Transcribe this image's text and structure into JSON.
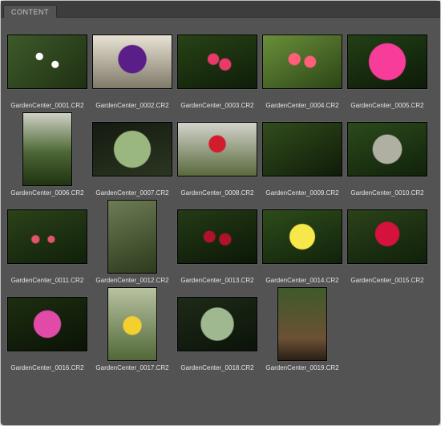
{
  "panel": {
    "tab_label": "CONTENT"
  },
  "files": [
    {
      "name": "GardenCenter_0001.CR2",
      "orient": "landscape",
      "palette": "p1"
    },
    {
      "name": "GardenCenter_0002.CR2",
      "orient": "landscape",
      "palette": "p2"
    },
    {
      "name": "GardenCenter_0003.CR2",
      "orient": "landscape",
      "palette": "p3"
    },
    {
      "name": "GardenCenter_0004.CR2",
      "orient": "landscape",
      "palette": "p4"
    },
    {
      "name": "GardenCenter_0005.CR2",
      "orient": "landscape",
      "palette": "p5"
    },
    {
      "name": "GardenCenter_0006.CR2",
      "orient": "portrait",
      "palette": "p6"
    },
    {
      "name": "GardenCenter_0007.CR2",
      "orient": "landscape",
      "palette": "p7"
    },
    {
      "name": "GardenCenter_0008.CR2",
      "orient": "landscape",
      "palette": "p8"
    },
    {
      "name": "GardenCenter_0009.CR2",
      "orient": "landscape",
      "palette": "p9"
    },
    {
      "name": "GardenCenter_0010.CR2",
      "orient": "landscape",
      "palette": "p10"
    },
    {
      "name": "GardenCenter_0011.CR2",
      "orient": "landscape",
      "palette": "p11"
    },
    {
      "name": "GardenCenter_0012.CR2",
      "orient": "portrait",
      "palette": "p12"
    },
    {
      "name": "GardenCenter_0013.CR2",
      "orient": "landscape",
      "palette": "p13"
    },
    {
      "name": "GardenCenter_0014.CR2",
      "orient": "landscape",
      "palette": "p14"
    },
    {
      "name": "GardenCenter_0015.CR2",
      "orient": "landscape",
      "palette": "p15"
    },
    {
      "name": "GardenCenter_0016.CR2",
      "orient": "landscape",
      "palette": "p16"
    },
    {
      "name": "GardenCenter_0017.CR2",
      "orient": "portrait",
      "palette": "p17"
    },
    {
      "name": "GardenCenter_0018.CR2",
      "orient": "landscape",
      "palette": "p18"
    },
    {
      "name": "GardenCenter_0019.CR2",
      "orient": "portrait",
      "palette": "p19"
    }
  ]
}
